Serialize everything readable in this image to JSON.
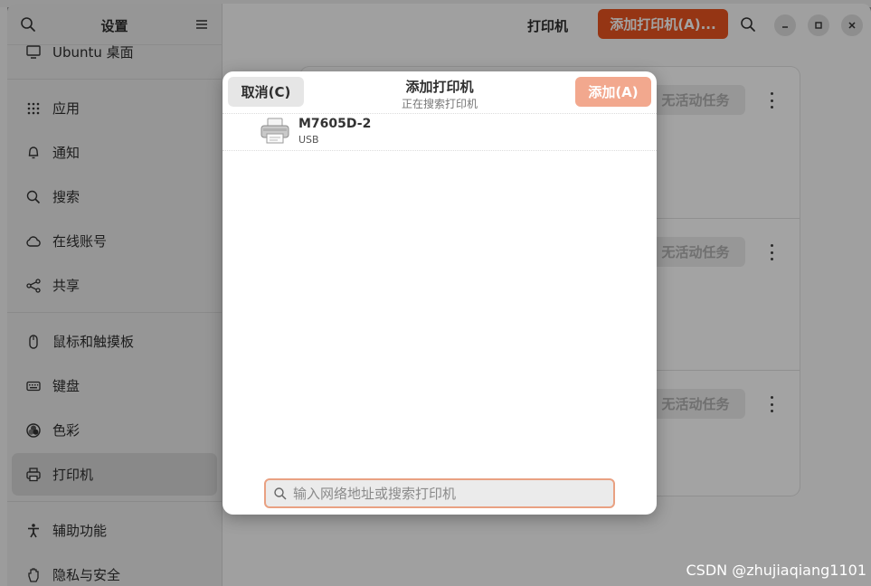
{
  "sidebar": {
    "title": "设置",
    "items": [
      {
        "label": "Ubuntu 桌面",
        "icon": "desktop-icon"
      },
      {
        "label": "应用",
        "icon": "apps-grid-icon"
      },
      {
        "label": "通知",
        "icon": "bell-icon"
      },
      {
        "label": "搜索",
        "icon": "search-icon"
      },
      {
        "label": "在线账号",
        "icon": "cloud-icon"
      },
      {
        "label": "共享",
        "icon": "share-icon"
      },
      {
        "label": "鼠标和触摸板",
        "icon": "mouse-icon"
      },
      {
        "label": "键盘",
        "icon": "keyboard-icon"
      },
      {
        "label": "色彩",
        "icon": "color-icon"
      },
      {
        "label": "打印机",
        "icon": "printer-icon",
        "active": true
      },
      {
        "label": "辅助功能",
        "icon": "accessibility-icon"
      },
      {
        "label": "隐私与安全",
        "icon": "hand-icon"
      }
    ]
  },
  "header": {
    "title": "打印机",
    "add_printer_label": "添加打印机(A)..."
  },
  "printer_rows": [
    {
      "job_label": "无活动任务"
    },
    {
      "job_label": "无活动任务"
    },
    {
      "job_label": "无活动任务"
    }
  ],
  "dialog": {
    "title": "添加打印机",
    "subtitle": "正在搜索打印机",
    "cancel_label": "取消(C)",
    "add_label": "添加(A)",
    "printers": [
      {
        "name": "M7605D-2",
        "connection": "USB"
      }
    ],
    "search_placeholder": "输入网络地址或搜索打印机"
  },
  "watermark": "CSDN @zhujiaqiang1101",
  "colors": {
    "accent": "#e95420",
    "accent_disabled": "#f2a88e",
    "focus_border": "#e9a182"
  }
}
